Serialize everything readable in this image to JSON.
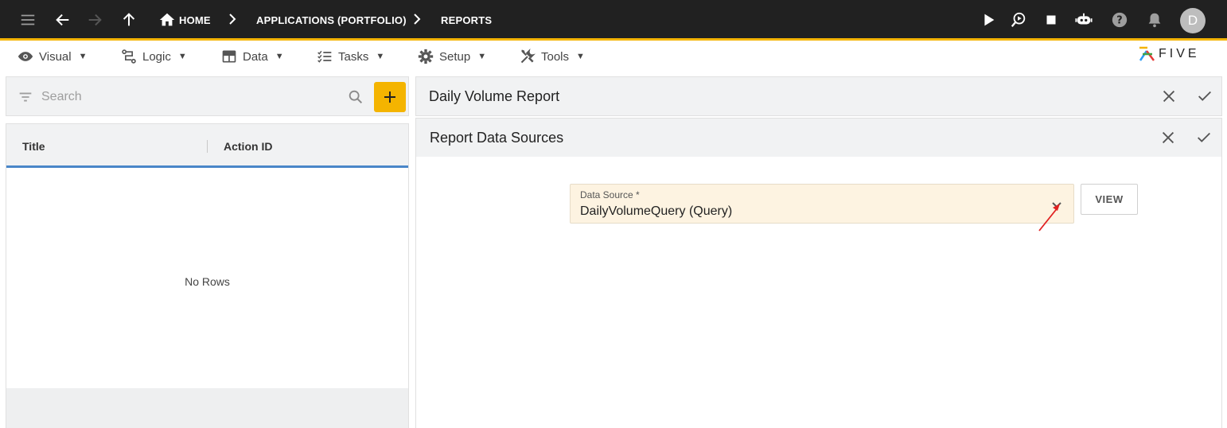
{
  "topbar": {
    "breadcrumbs": {
      "home": "HOME",
      "applications": "APPLICATIONS (PORTFOLIO)",
      "reports": "REPORTS"
    },
    "avatar_initial": "D",
    "icons": [
      "menu-icon",
      "back-arrow-icon",
      "forward-arrow-icon",
      "up-arrow-icon",
      "home-icon",
      "play-icon",
      "debug-run-icon",
      "stop-icon",
      "chat-bot-icon",
      "help-icon",
      "bell-icon"
    ],
    "accent_color": "#f4b400"
  },
  "menubar": {
    "items": [
      {
        "label": "Visual",
        "icon": "eye-icon"
      },
      {
        "label": "Logic",
        "icon": "logic-flow-icon"
      },
      {
        "label": "Data",
        "icon": "table-icon"
      },
      {
        "label": "Tasks",
        "icon": "checklist-icon"
      },
      {
        "label": "Setup",
        "icon": "gear-icon"
      },
      {
        "label": "Tools",
        "icon": "tools-icon"
      }
    ],
    "caret": "▼",
    "logo_text": "FIVE"
  },
  "left_panel": {
    "search_placeholder": "Search",
    "columns": [
      "Title",
      "Action ID"
    ],
    "empty_text": "No Rows"
  },
  "forms": {
    "parent_title": "Daily Volume Report",
    "child_title": "Report Data Sources",
    "data_source_field": {
      "label": "Data Source *",
      "value": "DailyVolumeQuery (Query)"
    },
    "view_button": "VIEW"
  }
}
